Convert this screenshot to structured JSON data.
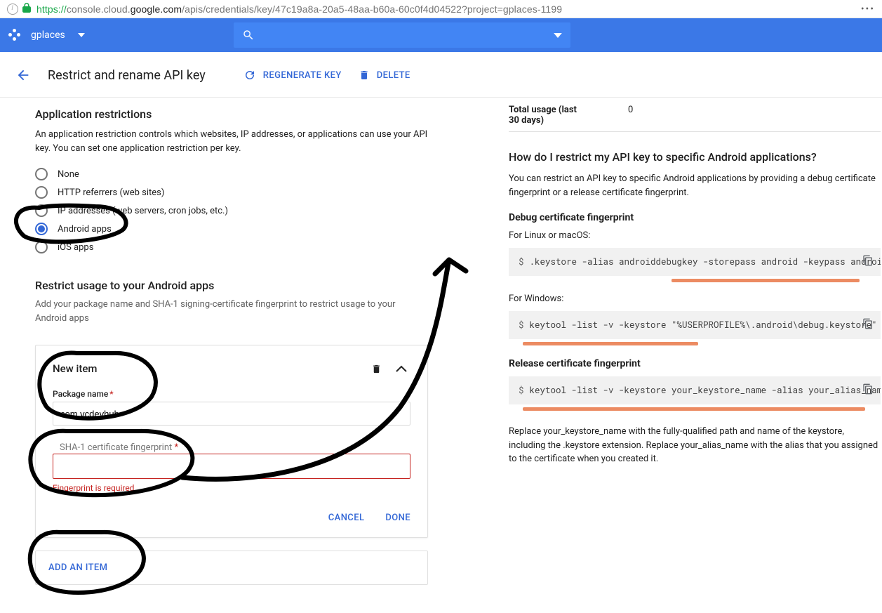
{
  "url": {
    "secure_prefix": "https://",
    "domain_light": "console.cloud.",
    "domain_bold": "google.com",
    "path": "/apis/credentials/key/47c19a8a-20a5-48aa-b60a-60c0f4d04522?project=gplaces-1199"
  },
  "topbar": {
    "project_name": "gplaces"
  },
  "header": {
    "title": "Restrict and rename API key",
    "regenerate_label": "REGENERATE KEY",
    "delete_label": "DELETE"
  },
  "left": {
    "section_title": "Application restrictions",
    "section_desc": "An application restriction controls which websites, IP addresses, or applications can use your API key. You can set one application restriction per key.",
    "radios": [
      {
        "label": "None",
        "selected": false
      },
      {
        "label": "HTTP referrers (web sites)",
        "selected": false
      },
      {
        "label": "IP addresses (web servers, cron jobs, etc.)",
        "selected": false
      },
      {
        "label": "Android apps",
        "selected": true
      },
      {
        "label": "iOS apps",
        "selected": false
      }
    ],
    "restrict_title": "Restrict usage to your Android apps",
    "restrict_desc": "Add your package name and SHA-1 signing-certificate fingerprint to restrict usage to your Android apps",
    "card": {
      "title": "New item",
      "pkg_label": "Package name",
      "pkg_value": "com.vcdevhub",
      "sha_label": "SHA-1 certificate fingerprint",
      "sha_placeholder": "",
      "sha_error": "Fingerprint is required",
      "cancel": "CANCEL",
      "done": "DONE"
    },
    "add_item_label": "ADD AN ITEM"
  },
  "right": {
    "usage_label": "Total usage (last 30 days)",
    "usage_value": "0",
    "help_title": "How do I restrict my API key to specific Android applications?",
    "help_desc": "You can restrict an API key to specific Android applications by providing a debug certificate fingerprint or a release certificate fingerprint.",
    "debug_heading": "Debug certificate fingerprint",
    "debug_os_label": "For Linux or macOS:",
    "debug_cmd_linux": ".keystore -alias androiddebugkey -storepass android -keypass android",
    "debug_win_label": "For Windows:",
    "debug_cmd_win": "keytool -list -v -keystore \"%USERPROFILE%\\.android\\debug.keystore\" ·",
    "release_heading": "Release certificate fingerprint",
    "release_cmd": "keytool -list -v -keystore your_keystore_name -alias your_alias_name",
    "note": "Replace your_keystore_name with the fully-qualified path and name of the keystore, including the .keystore extension. Replace your_alias_name with the alias that you assigned to the certificate when you created it."
  }
}
